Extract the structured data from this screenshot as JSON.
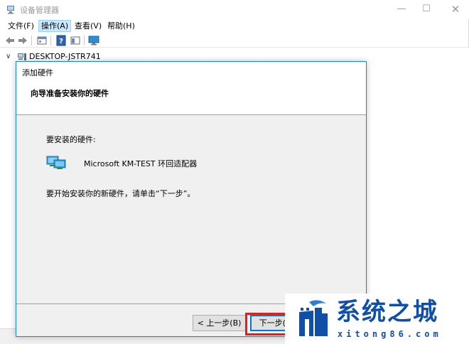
{
  "window": {
    "title": "设备管理器",
    "controls": {
      "minimize": "—",
      "maximize": "☐",
      "close": "✕"
    }
  },
  "menubar": {
    "items": [
      {
        "label": "文件(F)"
      },
      {
        "label": "操作(A)"
      },
      {
        "label": "查看(V)"
      },
      {
        "label": "帮助(H)"
      }
    ]
  },
  "tree": {
    "root_label": "DESKTOP-JSTR741"
  },
  "dialog": {
    "title": "添加硬件",
    "header": "向导准备安装你的硬件",
    "hardware_label": "要安装的硬件:",
    "hardware_name": "Microsoft KM-TEST 环回适配器",
    "instruction": "要开始安装你的新硬件，请单击“下一步”。",
    "back_button": "< 上一步(B)",
    "next_button": "下一步(N)"
  },
  "watermark": {
    "title": "系统之城",
    "url": "xitong86.com"
  },
  "colors": {
    "accent": "#0078d7",
    "highlight": "#e0201b",
    "watermark": "#0f4fa8"
  },
  "icons": {
    "back": "back-arrow-icon",
    "forward": "forward-arrow-icon",
    "properties": "properties-icon",
    "help": "help-icon",
    "monitor": "monitor-icon",
    "computer": "computer-icon",
    "network_adapter": "network-adapter-icon"
  }
}
